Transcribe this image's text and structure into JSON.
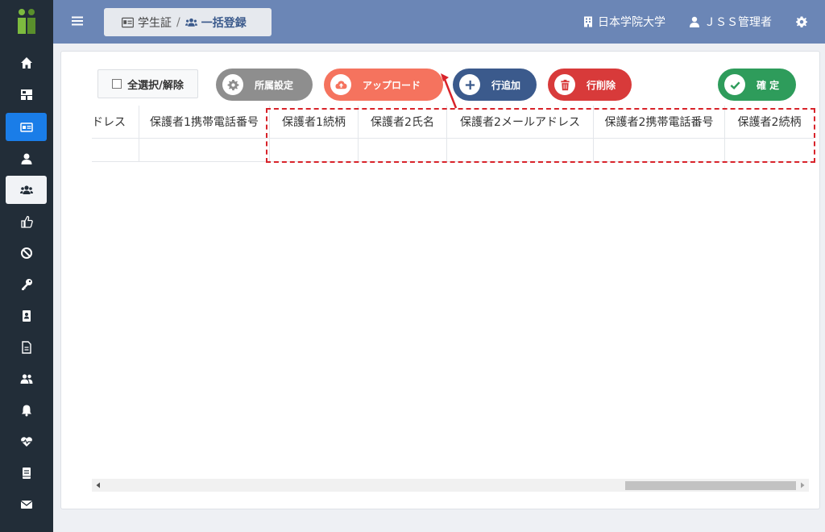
{
  "sidebar": {
    "icons": [
      "home-icon",
      "dashboard-icon",
      "id-card-icon",
      "user-icon",
      "users-icon",
      "thumbs-up-icon",
      "ban-icon",
      "key-icon",
      "address-card-icon",
      "file-icon",
      "group-icon",
      "bell-icon",
      "heartbeat-icon",
      "book-icon",
      "envelope-icon"
    ]
  },
  "header": {
    "breadcrumb_parent": "学生証",
    "breadcrumb_sep": "/",
    "breadcrumb_current": "一括登録",
    "university": "日本学院大学",
    "user": "ＪＳＳ管理者"
  },
  "toolbar": {
    "select_all": "全選択/解除",
    "affiliation": "所属設定",
    "upload": "アップロード",
    "add_row": "行追加",
    "delete_row": "行削除",
    "confirm": "確 定"
  },
  "colors": {
    "sidebar": "#222d38",
    "header": "#6b86b6",
    "affiliation": "#8e8e8e",
    "upload": "#f5735e",
    "add_row": "#3b5a8c",
    "delete_row": "#d83a3a",
    "confirm": "#2e9c5b",
    "highlight": "#d8232a"
  },
  "table": {
    "columns": [
      "ドレス",
      "保護者1携帯電話番号",
      "保護者1続柄",
      "保護者2氏名",
      "保護者2メールアドレス",
      "保護者2携帯電話番号",
      "保護者2続柄"
    ]
  }
}
